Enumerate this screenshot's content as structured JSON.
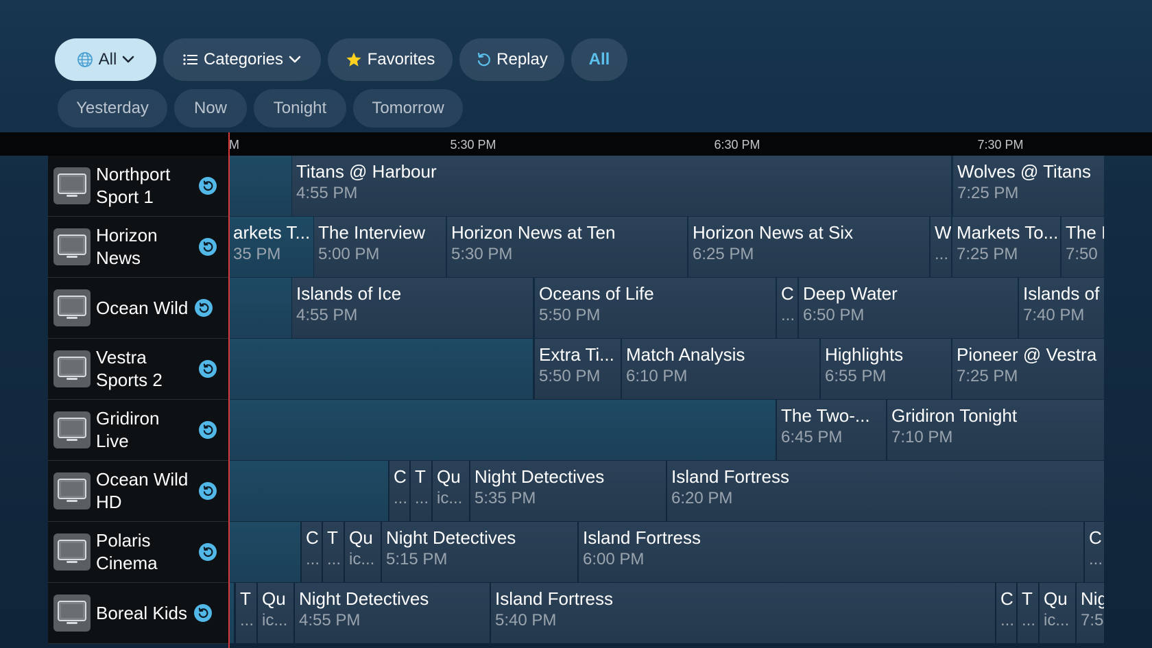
{
  "toolbar": {
    "all_dropdown": "All",
    "categories": "Categories",
    "favorites": "Favorites",
    "replay": "Replay",
    "all_filter": "All"
  },
  "days": [
    "Yesterday",
    "Now",
    "Tonight",
    "Tomorrow"
  ],
  "timebar": {
    "clipped": "M",
    "t1": "5:30 PM",
    "t2": "6:30 PM",
    "t3": "7:30 PM"
  },
  "channels": [
    {
      "name": "Northport Sport 1",
      "programs": [
        {
          "title": "",
          "time": ""
        },
        {
          "title": "Titans @ Harbour",
          "time": "4:55 PM"
        },
        {
          "title": "Wolves @ Titans",
          "time": "7:25 PM"
        }
      ]
    },
    {
      "name": "Horizon News",
      "programs": [
        {
          "title": "arkets T...",
          "time": "35 PM"
        },
        {
          "title": "The Interview",
          "time": "5:00 PM"
        },
        {
          "title": "Horizon News at Ten",
          "time": "5:30 PM"
        },
        {
          "title": "Horizon News at Six",
          "time": "6:25 PM"
        },
        {
          "title": "W",
          "time": "..."
        },
        {
          "title": "Markets To...",
          "time": "7:25 PM"
        },
        {
          "title": "The I",
          "time": "7:50"
        }
      ]
    },
    {
      "name": "Ocean Wild",
      "programs": [
        {
          "title": "",
          "time": ""
        },
        {
          "title": "Islands of Ice",
          "time": "4:55 PM"
        },
        {
          "title": "Oceans of Life",
          "time": "5:50 PM"
        },
        {
          "title": "C",
          "time": "..."
        },
        {
          "title": "Deep Water",
          "time": "6:50 PM"
        },
        {
          "title": "Islands of",
          "time": "7:40 PM"
        }
      ]
    },
    {
      "name": "Vestra Sports 2",
      "programs": [
        {
          "title": "",
          "time": ""
        },
        {
          "title": "Extra Ti...",
          "time": "5:50 PM"
        },
        {
          "title": "Match Analysis",
          "time": "6:10 PM"
        },
        {
          "title": "Highlights",
          "time": "6:55 PM"
        },
        {
          "title": "Pioneer @ Vestra",
          "time": "7:25 PM"
        }
      ]
    },
    {
      "name": "Gridiron Live",
      "programs": [
        {
          "title": "",
          "time": ""
        },
        {
          "title": "The Two-...",
          "time": "6:45 PM"
        },
        {
          "title": "Gridiron Tonight",
          "time": "7:10 PM"
        }
      ]
    },
    {
      "name": "Ocean Wild HD",
      "programs": [
        {
          "title": "",
          "time": ""
        },
        {
          "title": "C",
          "time": "..."
        },
        {
          "title": "T",
          "time": "..."
        },
        {
          "title": "Qu",
          "time": "ic..."
        },
        {
          "title": "Night Detectives",
          "time": "5:35 PM"
        },
        {
          "title": "Island Fortress",
          "time": "6:20 PM"
        }
      ]
    },
    {
      "name": "Polaris Cinema",
      "programs": [
        {
          "title": "",
          "time": ""
        },
        {
          "title": "C",
          "time": "..."
        },
        {
          "title": "T",
          "time": "..."
        },
        {
          "title": "Qu",
          "time": "ic..."
        },
        {
          "title": "Night Detectives",
          "time": "5:15 PM"
        },
        {
          "title": "Island Fortress",
          "time": "6:00 PM"
        },
        {
          "title": "C",
          "time": "..."
        }
      ]
    },
    {
      "name": "Boreal Kids",
      "programs": [
        {
          "title": ":",
          "time": ""
        },
        {
          "title": "T",
          "time": "..."
        },
        {
          "title": "Qu",
          "time": "ic..."
        },
        {
          "title": "Night Detectives",
          "time": "4:55 PM"
        },
        {
          "title": "Island Fortress",
          "time": "5:40 PM"
        },
        {
          "title": "C",
          "time": "..."
        },
        {
          "title": "T",
          "time": "..."
        },
        {
          "title": "Qu",
          "time": "ic..."
        },
        {
          "title": "Nig",
          "time": "7:5"
        }
      ]
    }
  ]
}
